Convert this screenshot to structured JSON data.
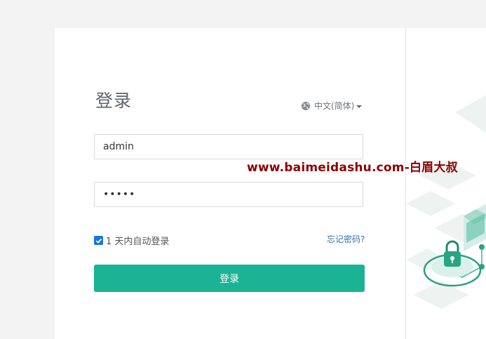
{
  "login": {
    "title": "登录",
    "language": "中文(简体)",
    "username_value": "admin",
    "password_value": "•••••",
    "remember_label": "1 天内自动登录",
    "remember_checked": true,
    "forgot_label": "忘记密码?",
    "submit_label": "登录"
  },
  "watermark": {
    "text": "www.baimeidashu.com-白眉大叔"
  },
  "colors": {
    "accent": "#1ab394",
    "link": "#3b6eaa",
    "watermark": "#8b0000",
    "checkbox": "#1a73e8"
  }
}
